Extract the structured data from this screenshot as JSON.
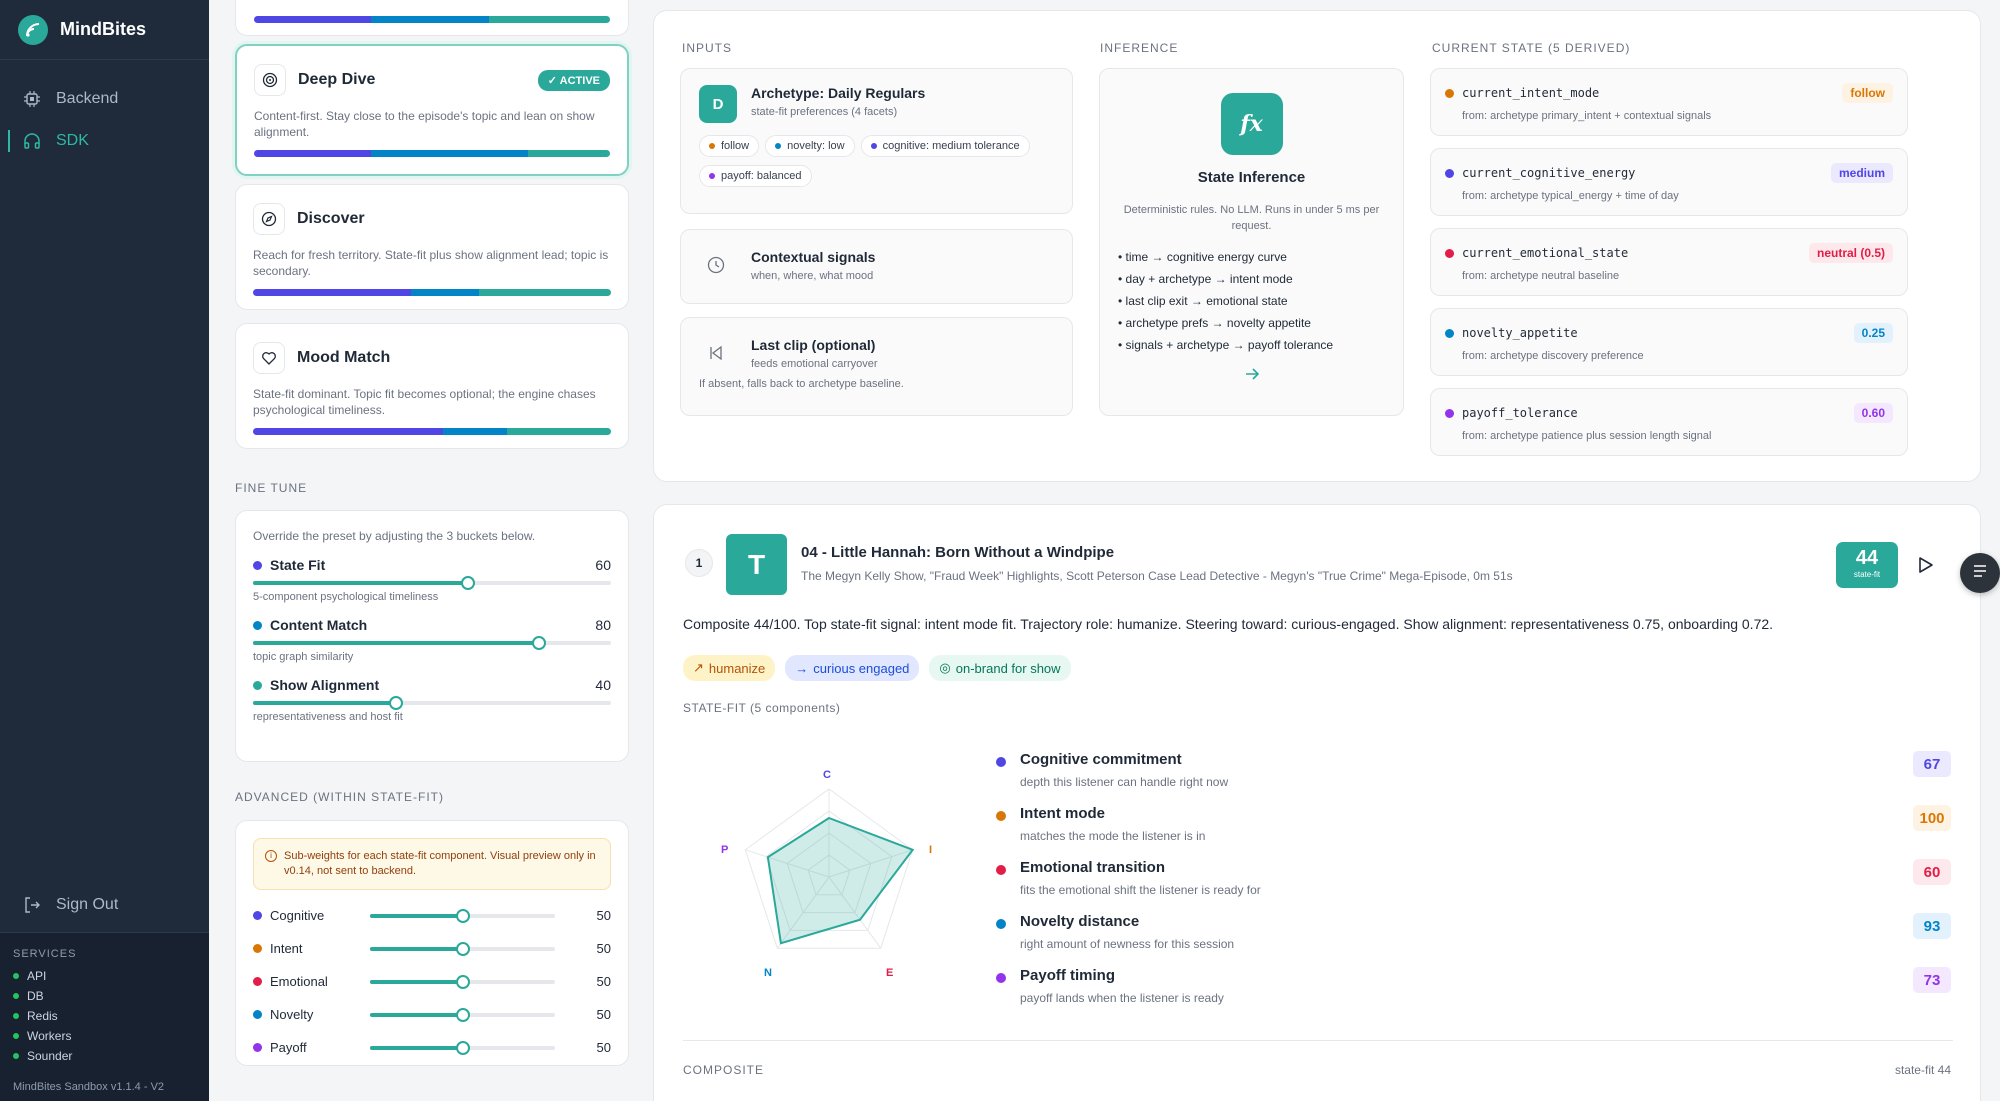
{
  "app": {
    "name": "MindBites",
    "version": "MindBites Sandbox v1.1.4 - V2"
  },
  "nav": {
    "items": [
      {
        "label": "Backend"
      },
      {
        "label": "SDK"
      }
    ],
    "sign_out": "Sign Out"
  },
  "services": {
    "title": "SERVICES",
    "items": [
      "API",
      "DB",
      "Redis",
      "Workers",
      "Sounder"
    ]
  },
  "presets": [
    {
      "title": "Deep Dive",
      "badge": "ACTIVE",
      "desc": "Content-first. Stay close to the episode's topic and lean on show alignment.",
      "bars": [
        33,
        44,
        23
      ]
    },
    {
      "title": "Discover",
      "desc": "Reach for fresh territory. State-fit plus show alignment lead; topic is secondary.",
      "bars": [
        44,
        19,
        37
      ]
    },
    {
      "title": "Mood Match",
      "desc": "State-fit dominant. Topic fit becomes optional; the engine chases psychological timeliness.",
      "bars": [
        53,
        18,
        29
      ]
    }
  ],
  "fine_tune": {
    "label": "FINE TUNE",
    "intro": "Override the preset by adjusting the 3 buckets below.",
    "sliders": [
      {
        "label": "State Fit",
        "value": "60",
        "sub": "5-component psychological timeliness",
        "color": "#4f46e5",
        "pct": 60
      },
      {
        "label": "Content Match",
        "value": "80",
        "sub": "topic graph similarity",
        "color": "#0284c7",
        "pct": 80
      },
      {
        "label": "Show Alignment",
        "value": "40",
        "sub": "representativeness and host fit",
        "color": "#2aa89a",
        "pct": 40
      }
    ]
  },
  "advanced": {
    "label": "ADVANCED (WITHIN STATE-FIT)",
    "note": "Sub-weights for each state-fit component. Visual preview only in v0.14, not sent to backend.",
    "items": [
      {
        "label": "Cognitive",
        "value": "50",
        "color": "#4f46e5"
      },
      {
        "label": "Intent",
        "value": "50",
        "color": "#d97706"
      },
      {
        "label": "Emotional",
        "value": "50",
        "color": "#e11d48"
      },
      {
        "label": "Novelty",
        "value": "50",
        "color": "#0284c7"
      },
      {
        "label": "Payoff",
        "value": "50",
        "color": "#9333ea"
      }
    ]
  },
  "pipeline": {
    "inputs_label": "INPUTS",
    "inference_label": "INFERENCE",
    "state_label": "CURRENT STATE (5 DERIVED)",
    "archetype": {
      "avatar": "D",
      "title": "Archetype: Daily Regulars",
      "sub": "state-fit preferences (4 facets)",
      "chips": [
        {
          "label": "follow",
          "color": "#d97706"
        },
        {
          "label": "novelty: low",
          "color": "#0284c7"
        },
        {
          "label": "cognitive: medium tolerance",
          "color": "#4f46e5"
        },
        {
          "label": "payoff: balanced",
          "color": "#9333ea"
        }
      ]
    },
    "contextual": {
      "title": "Contextual signals",
      "sub": "when, where, what mood"
    },
    "last_clip": {
      "title": "Last clip (optional)",
      "sub": "feeds emotional carryover",
      "note": "If absent, falls back to archetype baseline."
    },
    "inference": {
      "icon": "fx",
      "title": "State Inference",
      "desc": "Deterministic rules. No LLM. Runs in under 5 ms per request.",
      "rules": [
        "• time → cognitive energy curve",
        "• day + archetype → intent mode",
        "• last clip exit → emotional state",
        "• archetype prefs → novelty appetite",
        "• signals + archetype → payoff tolerance"
      ]
    },
    "states": [
      {
        "name": "current_intent_mode",
        "from": "from: archetype primary_intent + contextual signals",
        "value": "follow",
        "color": "#d97706",
        "bg": "#fef3e2"
      },
      {
        "name": "current_cognitive_energy",
        "from": "from: archetype typical_energy + time of day",
        "value": "medium",
        "color": "#4f46e5",
        "bg": "#ebe9fd"
      },
      {
        "name": "current_emotional_state",
        "from": "from: archetype neutral baseline",
        "value": "neutral (0.5)",
        "color": "#e11d48",
        "bg": "#fde8ec"
      },
      {
        "name": "novelty_appetite",
        "from": "from: archetype discovery preference",
        "value": "0.25",
        "color": "#0284c7",
        "bg": "#e2f1fb"
      },
      {
        "name": "payoff_tolerance",
        "from": "from: archetype patience plus session length signal",
        "value": "0.60",
        "color": "#9333ea",
        "bg": "#f3e8fd"
      }
    ]
  },
  "result": {
    "rank": "1",
    "avatar": "T",
    "title": "04 - Little Hannah: Born Without a Windpipe",
    "subtitle": "The Megyn Kelly Show, \"Fraud Week\" Highlights, Scott Peterson Case Lead Detective - Megyn's \"True Crime\" Mega-Episode, 0m 51s",
    "score": "44",
    "score_label": "state-fit",
    "summary": "Composite 44/100. Top state-fit signal: intent mode fit. Trajectory role: humanize. Steering toward: curious-engaged. Show alignment: representativeness 0.75, onboarding 0.72.",
    "tags": [
      {
        "label": "humanize",
        "icon": "↗",
        "color": "#b45309",
        "bg": "#fef3c7"
      },
      {
        "label": "curious engaged",
        "icon": "→",
        "color": "#1d4ed8",
        "bg": "#e0e7ff"
      },
      {
        "label": "on-brand for show",
        "icon": "◎",
        "color": "#047857",
        "bg": "#e7f7f1"
      }
    ],
    "state_fit_label": "STATE-FIT (5 components)",
    "radar_labels": {
      "C": "C",
      "I": "I",
      "E": "E",
      "N": "N",
      "P": "P"
    },
    "components": [
      {
        "name": "Cognitive commitment",
        "sub": "depth this listener can handle right now",
        "score": 67,
        "color": "#4f46e5",
        "bg": "#ebe9fd"
      },
      {
        "name": "Intent mode",
        "sub": "matches the mode the listener is in",
        "score": 100,
        "color": "#d97706",
        "bg": "#fef3e2"
      },
      {
        "name": "Emotional transition",
        "sub": "fits the emotional shift the listener is ready for",
        "score": 60,
        "color": "#e11d48",
        "bg": "#fde8ec"
      },
      {
        "name": "Novelty distance",
        "sub": "right amount of newness for this session",
        "score": 93,
        "color": "#0284c7",
        "bg": "#e2f1fb"
      },
      {
        "name": "Payoff timing",
        "sub": "payoff lands when the listener is ready",
        "score": 73,
        "color": "#9333ea",
        "bg": "#f3e8fd"
      }
    ],
    "composite_label": "COMPOSITE",
    "composite_value": "state-fit 44"
  }
}
